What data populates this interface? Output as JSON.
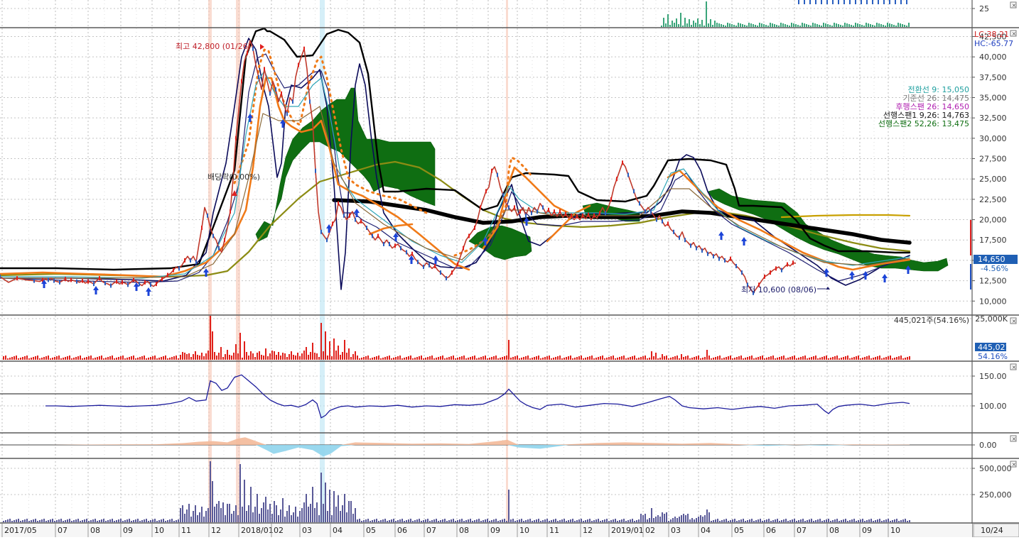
{
  "chart_data": {
    "type": "line",
    "colors": {
      "price": "#c0392b",
      "ichimoku_cloud": "#0f6e12",
      "long_ma": "#000000",
      "mid_ma": "#8c8c14",
      "upper_line": "#c8a000",
      "band": "#0b0b5a",
      "volume_up": "#e0201a",
      "volume_down": "#2a5fc0",
      "indicator": "#1c1c9c",
      "oscillator_up": "#f3b999",
      "oscillator_down": "#8fd4ec",
      "bottom_volume": "#5a5a98",
      "top_volume": "#3aa57a",
      "current_badge": "#1f5fb4",
      "lc": "#d02020",
      "hc": "#2040c0"
    },
    "x_axis": {
      "tick_labels": [
        "2017/05",
        "07",
        "08",
        "09",
        "10",
        "11",
        "12",
        "2018/01",
        "02",
        "03",
        "04",
        "05",
        "06",
        "07",
        "08",
        "09",
        "10",
        "11",
        "12",
        "2019/01",
        "02",
        "03",
        "04",
        "05",
        "06",
        "07",
        "08",
        "09",
        "10"
      ],
      "date_label": "10/24"
    },
    "top_panel": {
      "tick_labels": [
        "25"
      ]
    },
    "price_panel": {
      "ylim": [
        9500,
        43500
      ],
      "tick_labels": [
        "42,500",
        "40,000",
        "37,500",
        "35,000",
        "32,500",
        "30,000",
        "27,500",
        "25,000",
        "22,500",
        "20,000",
        "17,500",
        "15,000",
        "12,500",
        "10,000"
      ],
      "lc_label": "LC:38.21",
      "hc_label": "HC:-65.77",
      "current_price": "14,650",
      "current_change": "-4.56%",
      "high_annotation": "최고 42,800 (01/26)",
      "low_annotation": "최저 10,600 (08/06)",
      "dividend_annotation": "배당락(0.00%)",
      "legend": [
        "전환선 9: 15,050",
        "기준선 26: 14,475",
        "후행스팬 26: 14,650",
        "선행스팬1 9,26: 14,763",
        "선행스팬2 52,26: 13,475"
      ],
      "series": [
        {
          "x": [
            0,
            12,
            24,
            36,
            48,
            56,
            60,
            64,
            68,
            72,
            76,
            80,
            84,
            88,
            92,
            96,
            100,
            104,
            108,
            112,
            116,
            120,
            124,
            128,
            132,
            136,
            140,
            144,
            148,
            152,
            156,
            160,
            164,
            168,
            172,
            176,
            180,
            184,
            188,
            192,
            196,
            200,
            204,
            208,
            212,
            216,
            220,
            224,
            228,
            232,
            236,
            240,
            244,
            248,
            252,
            256,
            260,
            264,
            268,
            272,
            276,
            280,
            284,
            288,
            292,
            296,
            300,
            304,
            308,
            312,
            316,
            320,
            324,
            328,
            332,
            336,
            340,
            344,
            348,
            352,
            356,
            360,
            364,
            368,
            372,
            376,
            380,
            384,
            388,
            392,
            396,
            400,
            404,
            408,
            412,
            416,
            420,
            424,
            428,
            432,
            436,
            440,
            444,
            448,
            452,
            456,
            460,
            464,
            468,
            472,
            476,
            480,
            484,
            488,
            492,
            496,
            500,
            504,
            508,
            512,
            516,
            520,
            524,
            528,
            532,
            536,
            540,
            544,
            548,
            552,
            556,
            560,
            564,
            568,
            572,
            576,
            580,
            584,
            588,
            592,
            596,
            600,
            604,
            608,
            612,
            616,
            620,
            624,
            628,
            632,
            636,
            640,
            644,
            648,
            652,
            656,
            660,
            664,
            668,
            672,
            676,
            680,
            684,
            688,
            692,
            696,
            700,
            704,
            708,
            712,
            716,
            720,
            724,
            728,
            732,
            736,
            740,
            744,
            748,
            752,
            756,
            760,
            764,
            768,
            772,
            776,
            780,
            784,
            788,
            792,
            796,
            800,
            804,
            808,
            812,
            816,
            820,
            824,
            828,
            832,
            836,
            840,
            844,
            848,
            852,
            856,
            860,
            864,
            868,
            872,
            876,
            880,
            884,
            888,
            892,
            896,
            900,
            904,
            908,
            912,
            916,
            920,
            924,
            928,
            932,
            936,
            940,
            944,
            948,
            952,
            956,
            960,
            964,
            968,
            972,
            976,
            980,
            984,
            988,
            992,
            996,
            1000,
            1004,
            1008,
            1012,
            1016,
            1020,
            1024,
            1028,
            1032,
            1036,
            1040,
            1044,
            1048,
            1052,
            1056,
            1060,
            1064,
            1068,
            1072,
            1076,
            1080,
            1084,
            1088,
            1092,
            1096,
            1100,
            1104,
            1108,
            1112,
            1116,
            1120,
            1124,
            1128,
            1132,
            1136,
            1140,
            1144,
            1148,
            1152,
            1156,
            1160,
            1164,
            1168,
            1172,
            1176,
            1180,
            1184,
            1188,
            1192,
            1196,
            1200,
            1204,
            1208,
            1212,
            1216,
            1220,
            1224,
            1228,
            1232,
            1236,
            1240,
            1244,
            1248,
            1252,
            1256,
            1260,
            1264,
            1268,
            1272,
            1276,
            1280
          ],
          "y": [
            13000,
            12300,
            12800,
            12600,
            12500,
            12400,
            12600,
            12700,
            12600,
            12800,
            12500,
            12400,
            12300,
            12500,
            12700,
            12400,
            12600,
            12500,
            12400,
            12300,
            12500,
            12200,
            12400,
            12300,
            12100,
            12500,
            12800,
            12400,
            12200,
            12100,
            11900,
            12200,
            12400,
            12100,
            12300,
            12200,
            12000,
            12300,
            12600,
            12400,
            12100,
            11900,
            12300,
            12400,
            12000,
            11800,
            12100,
            12500,
            12700,
            12900,
            13200,
            13400,
            13800,
            14200,
            14000,
            14400,
            15000,
            15500,
            15000,
            15500,
            14800,
            17000,
            19000,
            21500,
            20500,
            19000,
            18000,
            17500,
            16500,
            16000,
            17500,
            19000,
            21000,
            25000,
            30000,
            33500,
            37000,
            39500,
            40500,
            42000,
            41000,
            39000,
            37500,
            36000,
            38500,
            37000,
            35500,
            37000,
            36000,
            34500,
            35500,
            34000,
            33000,
            35000,
            34500,
            37500,
            39000,
            40000,
            41000,
            38500,
            34500,
            32000,
            26000,
            21000,
            18500,
            18000,
            17500,
            18500,
            19500,
            20000,
            22000,
            21500,
            20500,
            20000,
            20500,
            21000,
            20000,
            19500,
            19800,
            19500,
            19000,
            18500,
            18000,
            17500,
            18000,
            17500,
            17000,
            17500,
            17000,
            16500,
            16800,
            17000,
            16500,
            16200,
            16000,
            15500,
            15800,
            15200,
            14800,
            14500,
            14200,
            14700,
            14400,
            14000,
            14300,
            13800,
            13500,
            13200,
            12800,
            13000,
            13500,
            14000,
            14500,
            15500,
            16500,
            17500,
            18000,
            18500,
            19000,
            20000,
            21500,
            22500,
            23500,
            24000,
            26000,
            26500,
            25500,
            24000,
            23000,
            22000,
            21500,
            21000,
            21500,
            20500,
            21000,
            21500,
            20500,
            21500,
            20800,
            21500,
            21000,
            22000,
            21500,
            20800,
            21200,
            20500,
            21000,
            20400,
            21000,
            20300,
            20700,
            20200,
            20500,
            20000,
            20400,
            20000,
            20500,
            20100,
            20600,
            20000,
            20500,
            20200,
            20800,
            21500,
            20800,
            21500,
            22500,
            24000,
            25000,
            26000,
            27000,
            26500,
            25500,
            24500,
            23500,
            22500,
            22000,
            21500,
            21000,
            21500,
            21000,
            20500,
            20000,
            20500,
            19800,
            19200,
            19500,
            18800,
            18500,
            18000,
            17800,
            18500,
            17500,
            17200,
            16800,
            17200,
            16500,
            16800,
            16200,
            16500,
            15800,
            16000,
            15500,
            15800,
            15200,
            15500,
            15000,
            14800,
            15200,
            14700,
            14300,
            14000,
            13500,
            13000,
            12000,
            11500,
            11000,
            11500,
            12000,
            12500,
            13000,
            13200,
            13500,
            13800,
            14000,
            14200,
            13800,
            14200,
            14500,
            14300,
            14700,
            14650
          ]
        }
      ]
    },
    "volume_panel": {
      "tick_labels": [
        "25,000K"
      ],
      "header_text": "445,021주(54.16%)",
      "badge_value": "445,021",
      "badge_percent": "54.16%"
    },
    "indicator_panel": {
      "tick_labels": [
        "150.00",
        "100.00"
      ],
      "x": [
        64,
        80,
        100,
        120,
        140,
        160,
        180,
        200,
        220,
        240,
        256,
        266,
        276,
        290,
        296,
        304,
        312,
        320,
        330,
        340,
        350,
        360,
        370,
        380,
        390,
        400,
        410,
        420,
        430,
        440,
        446,
        452,
        458,
        464,
        472,
        480,
        490,
        500,
        520,
        540,
        560,
        580,
        600,
        620,
        640,
        660,
        680,
        700,
        710,
        716,
        724,
        732,
        740,
        750,
        760,
        770,
        790,
        810,
        830,
        850,
        870,
        890,
        910,
        930,
        942,
        950,
        960,
        970,
        990,
        1010,
        1030,
        1050,
        1070,
        1090,
        1110,
        1130,
        1150,
        1160,
        1166,
        1172,
        1180,
        1190,
        1210,
        1230,
        1250,
        1270,
        1280
      ],
      "y": [
        100,
        100,
        99,
        100,
        101,
        100,
        99,
        100,
        101,
        104,
        108,
        114,
        108,
        110,
        142,
        138,
        126,
        130,
        148,
        152,
        142,
        132,
        120,
        110,
        104,
        100,
        101,
        98,
        102,
        110,
        104,
        80,
        84,
        92,
        96,
        99,
        100,
        98,
        100,
        99,
        101,
        98,
        100,
        99,
        102,
        101,
        103,
        112,
        120,
        128,
        118,
        108,
        102,
        97,
        94,
        101,
        103,
        98,
        101,
        104,
        103,
        99,
        105,
        112,
        116,
        110,
        100,
        97,
        95,
        97,
        94,
        97,
        99,
        96,
        100,
        101,
        103,
        92,
        87,
        94,
        99,
        101,
        103,
        100,
        104,
        106,
        104
      ]
    },
    "oscillator_panel": {
      "tick_labels": [
        "0.00"
      ],
      "x": [
        70,
        120,
        170,
        220,
        260,
        280,
        300,
        320,
        335,
        345,
        360,
        375,
        385,
        400,
        420,
        440,
        455,
        465,
        480,
        500,
        540,
        580,
        620,
        660,
        700,
        714,
        730,
        760,
        800,
        840,
        880,
        920,
        960,
        1000,
        1040,
        1080,
        1120,
        1160,
        1200,
        1240,
        1280
      ],
      "y": [
        0,
        0.3,
        0.4,
        0.5,
        1.5,
        2.5,
        3,
        2,
        5,
        6,
        3,
        -4,
        -7,
        -5,
        -2,
        -4,
        -9,
        -7,
        -1,
        2,
        1.5,
        1,
        1.2,
        0.8,
        3,
        4,
        -2,
        -3,
        0.5,
        1.5,
        2,
        1.5,
        1,
        1.5,
        0.5,
        -0.8,
        0.2,
        -0.6,
        0.4,
        0.3,
        0.2
      ]
    },
    "bottom_volume_panel": {
      "tick_labels": [
        "500,000",
        "250,000"
      ]
    }
  }
}
